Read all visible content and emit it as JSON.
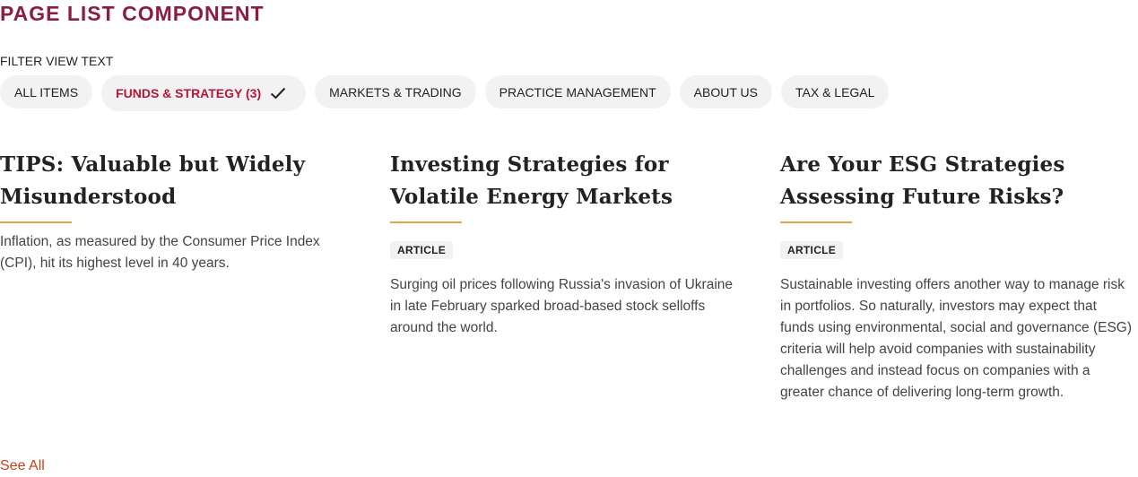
{
  "component_title": "PAGE LIST COMPONENT",
  "filter": {
    "label": "FILTER VIEW TEXT",
    "chips": [
      {
        "label": "ALL ITEMS"
      },
      {
        "label": "FUNDS & STRATEGY (3)"
      },
      {
        "label": "MARKETS & TRADING"
      },
      {
        "label": "PRACTICE MANAGEMENT"
      },
      {
        "label": "ABOUT US"
      },
      {
        "label": "TAX & LEGAL"
      }
    ],
    "active_index": 1
  },
  "cards": [
    {
      "title": "TIPS: Valuable but Widely Misunderstood",
      "badge": "",
      "description": "Inflation, as measured by the Consumer Price Index (CPI), hit its highest level in 40 years."
    },
    {
      "title": "Investing Strategies for Volatile Energy Markets",
      "badge": "ARTICLE",
      "description": "Surging oil prices following Russia's invasion of Ukraine in late February sparked broad-based stock selloffs around the world."
    },
    {
      "title": "Are Your ESG Strategies Assessing Future Risks?",
      "badge": "ARTICLE",
      "description": "Sustainable investing offers another way to manage risk in portfolios. So naturally, investors may expect that funds using environmental, social and governance (ESG) criteria will help avoid companies with sustainability challenges and instead focus on companies with a greater chance of delivering long-term growth."
    }
  ],
  "see_all_label": "See All",
  "icons": {
    "active_chip": "checkmark-icon"
  },
  "colors": {
    "title_accent": "#8b1d41",
    "active_chip_text": "#b3173a",
    "rule": "#e0a449",
    "link": "#c8411b",
    "chip_bg": "#f2f2f2"
  }
}
